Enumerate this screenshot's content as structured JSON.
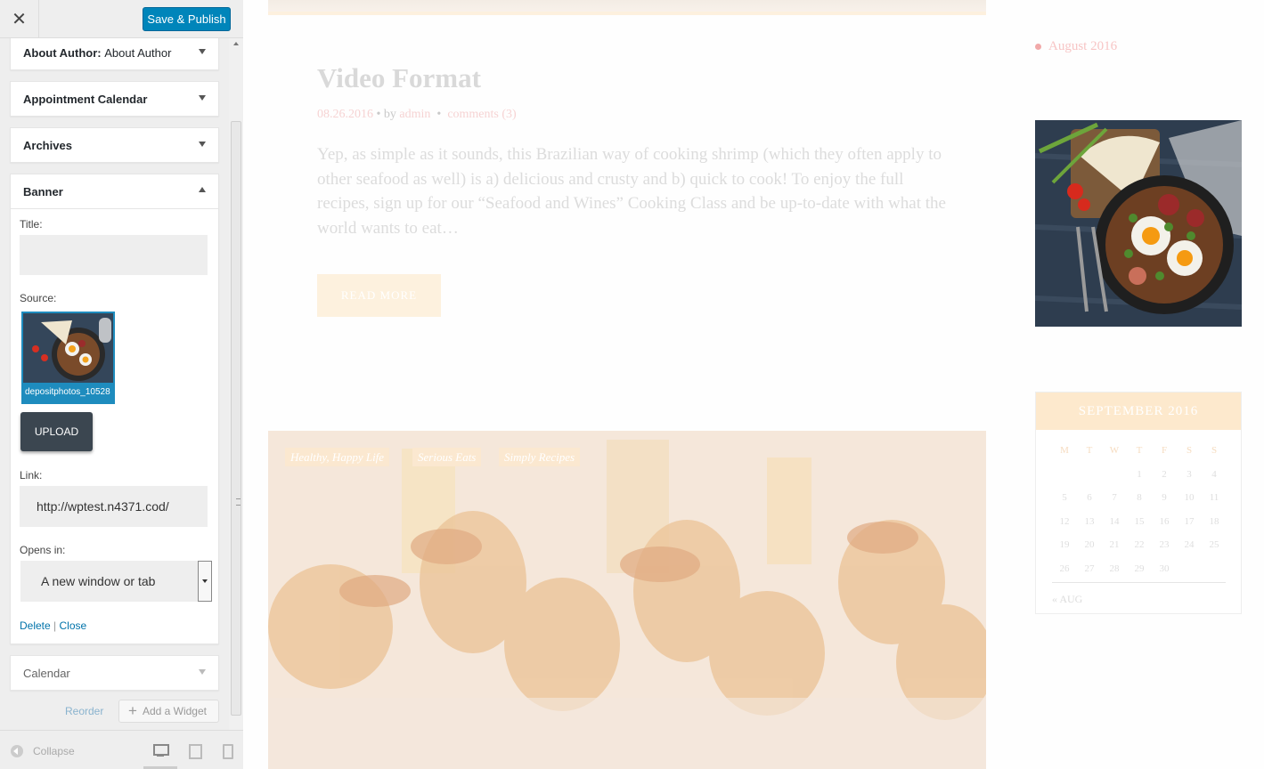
{
  "header": {
    "close_icon": "close-icon",
    "publish_label": "Save & Publish"
  },
  "widgets": {
    "about_author": {
      "label": "About Author",
      "subtitle": "About Author"
    },
    "appointment_calendar": {
      "label": "Appointment Calendar"
    },
    "archives": {
      "label": "Archives"
    },
    "banner": {
      "label": "Banner",
      "title_label": "Title:",
      "title_value": "",
      "source_label": "Source:",
      "source_filename": "depositphotos_10528",
      "upload_label": "UPLOAD",
      "link_label": "Link:",
      "link_value": "http://wptest.n4371.cod/",
      "opens_label": "Opens in:",
      "opens_value": "A new window or tab",
      "delete_label": "Delete",
      "separator": "|",
      "close_label": "Close"
    },
    "calendar": {
      "label": "Calendar"
    }
  },
  "actions": {
    "reorder_label": "Reorder",
    "add_widget_label": "Add a Widget"
  },
  "footer": {
    "collapse_label": "Collapse"
  },
  "preview": {
    "post_title": "Video Format",
    "post_date": "08.26.2016",
    "post_by": "• by",
    "post_author": "admin",
    "post_sep": "•",
    "post_comments": "comments (3)",
    "post_excerpt": "Yep, as simple as it sounds, this Brazilian way of cooking shrimp (which they often apply to other seafood as well) is a) delicious and crusty and b) quick to cook! To enjoy the full recipes, sign up for our “Seafood and Wines” Cooking Class and be up-to-date with what the world wants to eat…",
    "read_more": "READ MORE",
    "tags": [
      "Healthy, Happy Life",
      "Serious Eats",
      "Simply Recipes"
    ],
    "archive_item": "August 2016",
    "calendar": {
      "title": "SEPTEMBER 2016",
      "weekdays": [
        "M",
        "T",
        "W",
        "T",
        "F",
        "S",
        "S"
      ],
      "weeks": [
        [
          "",
          "",
          "",
          "1",
          "2",
          "3",
          "4"
        ],
        [
          "5",
          "6",
          "7",
          "8",
          "9",
          "10",
          "11"
        ],
        [
          "12",
          "13",
          "14",
          "15",
          "16",
          "17",
          "18"
        ],
        [
          "19",
          "20",
          "21",
          "22",
          "23",
          "24",
          "25"
        ],
        [
          "26",
          "27",
          "28",
          "29",
          "30",
          "",
          ""
        ]
      ],
      "prev_link": "« AUG"
    }
  },
  "colors": {
    "primary_button": "#0085ba",
    "link": "#0073aa",
    "accent_peach": "#fde9cd",
    "accent_pink": "#f6d3d3"
  }
}
